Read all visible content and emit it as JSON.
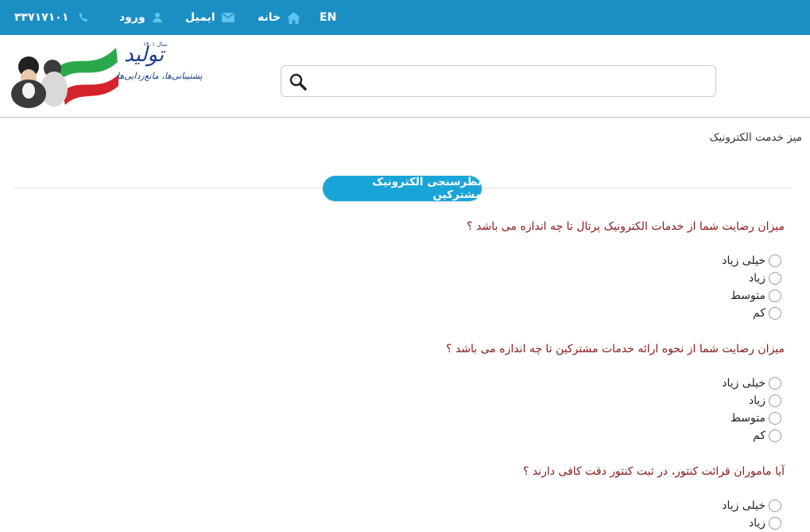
{
  "topbar": {
    "phone": "۳۳۷۱۷۱۰۱",
    "login": "ورود",
    "email": "ایمیل",
    "home": "خانه",
    "lang": "EN"
  },
  "header": {
    "logo_text": "تولید",
    "logo_subtitle": "پشتیبانی‌ها، مانع‌زدایی‌ها",
    "logo_year": "سال ۱۴۰۱",
    "search": {
      "placeholder": "",
      "value": ""
    }
  },
  "breadcrumb": "میز خدمت الکترونیک",
  "section_title": "نظرسنجی الکترونیک مشترکین",
  "questions": [
    {
      "text": "میزان رضایت شما از خدمات الکترونیک پرتال تا چه اندازه می باشد ؟",
      "options": [
        "خیلی زیاد",
        "زیاد",
        "متوسط",
        "کم"
      ]
    },
    {
      "text": "میزان رضایت شما از نحوه ارائه خدمات مشترکین تا چه اندازه می باشد ؟",
      "options": [
        "خیلی زیاد",
        "زیاد",
        "متوسط",
        "کم"
      ]
    },
    {
      "text": "آیا ماموران قرائت کنتور، در ثبت کنتور دقت کافی دارند ؟",
      "options": [
        "خیلی زیاد",
        "زیاد"
      ]
    }
  ],
  "colors": {
    "topbar": "#1b8fc3",
    "pill": "#1aa5d8",
    "question_text": "#8b1a1a",
    "icon": "#5fc4ef"
  }
}
